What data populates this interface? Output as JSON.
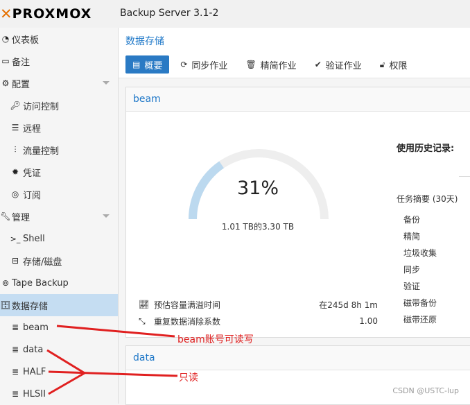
{
  "app": {
    "logo_text": "PROXMOX",
    "product": "Backup Server 3.1-2"
  },
  "sidebar": {
    "items": [
      {
        "label": "仪表板",
        "icon": "dashboard-icon"
      },
      {
        "label": "备注",
        "icon": "notes-icon"
      },
      {
        "label": "配置",
        "icon": "gears-icon"
      },
      {
        "label": "访问控制",
        "icon": "key-icon"
      },
      {
        "label": "远程",
        "icon": "server-icon"
      },
      {
        "label": "流量控制",
        "icon": "signal-icon"
      },
      {
        "label": "凭证",
        "icon": "certificate-icon"
      },
      {
        "label": "订阅",
        "icon": "support-icon"
      },
      {
        "label": "管理",
        "icon": "wrench-icon"
      },
      {
        "label": "Shell",
        "icon": "terminal-icon"
      },
      {
        "label": "存储/磁盘",
        "icon": "hdd-icon"
      },
      {
        "label": "Tape Backup",
        "icon": "tape-icon"
      },
      {
        "label": "数据存储",
        "icon": "database-icon"
      },
      {
        "label": "beam",
        "icon": "database-icon"
      },
      {
        "label": "data",
        "icon": "database-icon"
      },
      {
        "label": "HALF",
        "icon": "database-icon"
      },
      {
        "label": "HLSII",
        "icon": "database-icon"
      }
    ]
  },
  "main": {
    "title": "数据存储",
    "tabs": [
      {
        "label": "概要",
        "icon": "book-icon"
      },
      {
        "label": "同步作业",
        "icon": "refresh-icon"
      },
      {
        "label": "精简作业",
        "icon": "trash-icon"
      },
      {
        "label": "验证作业",
        "icon": "check-circle-icon"
      },
      {
        "label": "权限",
        "icon": "unlock-icon"
      }
    ],
    "panels": [
      {
        "title": "beam",
        "usage": {
          "percent": "31%",
          "fraction": 0.31,
          "detail": "1.01 TB的3.30 TB"
        },
        "stats": [
          {
            "label": "预估容量满溢时间",
            "value": "在245d 8h 1m",
            "icon": "chart-line-icon"
          },
          {
            "label": "重复数据消除系数",
            "value": "1.00",
            "icon": "compress-icon"
          }
        ],
        "history_title": "使用历史记录:",
        "tasks_title": "任务摘要 (30天)",
        "tasks": [
          "备份",
          "精简",
          "垃圾收集",
          "同步",
          "验证",
          "磁带备份",
          "磁带还原"
        ]
      },
      {
        "title": "data"
      }
    ]
  },
  "annotations": {
    "beam_note": "beam账号可读写",
    "readonly_note": "只读"
  },
  "watermark": "CSDN @USTC-lup",
  "colors": {
    "accent": "#2a7ac4",
    "logo_x": "#e57000",
    "selected": "#c5ddf2",
    "gauge_fill": "#bcd9ef",
    "gauge_track": "#eeeeee",
    "annotation": "#e02020"
  }
}
